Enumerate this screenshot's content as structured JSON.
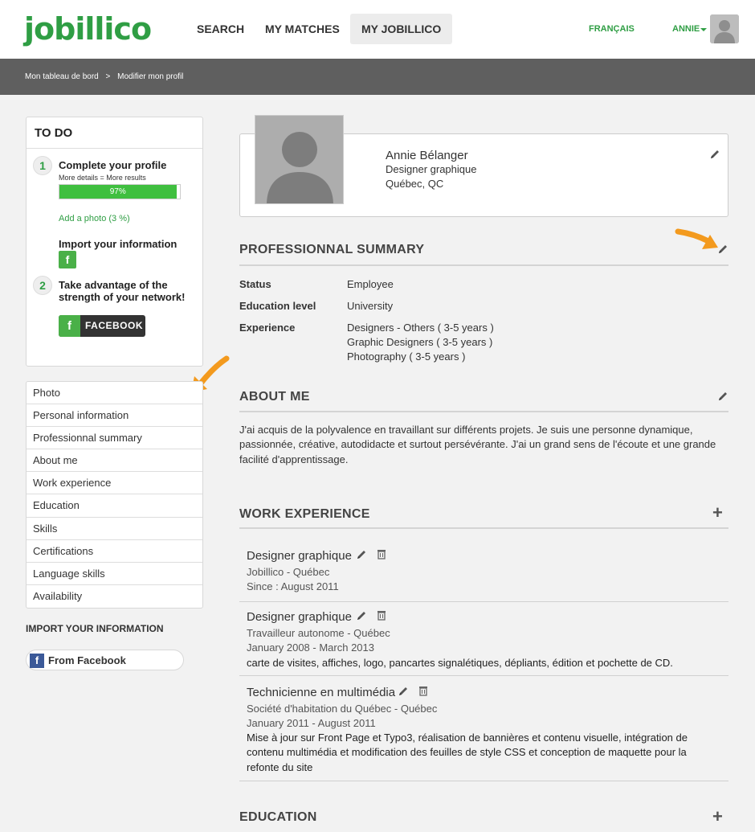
{
  "header": {
    "logo": "jobillico",
    "nav": [
      "SEARCH",
      "MY MATCHES",
      "MY JOBILLICO"
    ],
    "language": "FRANÇAIS",
    "user": "ANNIE"
  },
  "breadcrumb": {
    "home": "Mon tableau de bord",
    "separator": ">",
    "current": "Modifier mon profil"
  },
  "todo": {
    "title": "TO DO",
    "step1": {
      "number": "1",
      "title": "Complete your profile",
      "subtitle": "More details = More results",
      "progress_label": "97%",
      "progress": 0.97,
      "add_photo": "Add a photo (3 %)",
      "import_label": "Import your information"
    },
    "step2": {
      "number": "2",
      "title_line1": "Take advantage of the",
      "title_line2": "strength of your network!",
      "button": "FACEBOOK"
    }
  },
  "side_menu": [
    "Photo",
    "Personal information",
    "Professionnal summary",
    "About me",
    "Work experience",
    "Education",
    "Skills",
    "Certifications",
    "Language skills",
    "Availability"
  ],
  "import": {
    "title": "IMPORT YOUR INFORMATION",
    "from_facebook": "From Facebook"
  },
  "profile": {
    "name": "Annie Bélanger",
    "title": "Designer graphique",
    "location": "Québec, QC"
  },
  "summary": {
    "title": "PROFESSIONNAL SUMMARY",
    "status_label": "Status",
    "status": "Employee",
    "education_label": "Education level",
    "education": "University",
    "experience_label": "Experience",
    "experience": [
      "Designers - Others ( 3-5 years )",
      "Graphic Designers ( 3-5 years )",
      "Photography ( 3-5 years )"
    ]
  },
  "about": {
    "title": "ABOUT ME",
    "text": "J'ai acquis de la polyvalence en travaillant sur différents projets. Je suis une personne dynamique, passionnée, créative, autodidacte et surtout persévérante. J'ai un grand sens de l'écoute et une grande facilité d'apprentissage."
  },
  "work": {
    "title": "WORK EXPERIENCE",
    "jobs": [
      {
        "title": "Designer graphique",
        "company": "Jobillico - Québec",
        "dates": "Since : August 2011",
        "desc": ""
      },
      {
        "title": "Designer graphique",
        "company": "Travailleur autonome - Québec",
        "dates": "January 2008 - March 2013",
        "desc": "carte de visites, affiches, logo, pancartes signalétiques, dépliants, édition et pochette de CD."
      },
      {
        "title": "Technicienne en multimédia",
        "company": "Société d'habitation du Québec - Québec",
        "dates": "January 2011 - August 2011",
        "desc": "Mise à jour sur Front Page et Typo3, réalisation de bannières et contenu visuelle, intégration de contenu multimédia et modification des feuilles de style CSS et conception de maquette pour la refonte du site"
      }
    ]
  },
  "education": {
    "title": "EDUCATION"
  },
  "colors": {
    "brand_green": "#2f9e44",
    "accent_orange": "#f39a1e",
    "breadcrumb_bar": "#5f5f5f"
  }
}
